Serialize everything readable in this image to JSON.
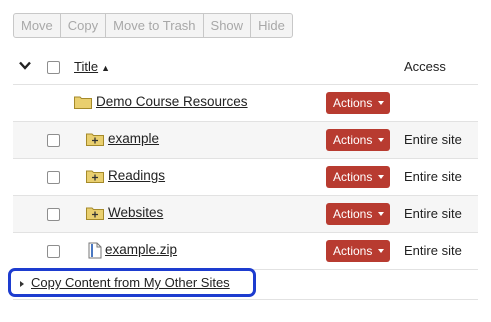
{
  "toolbar": {
    "buttons": [
      "Move",
      "Copy",
      "Move to Trash",
      "Show",
      "Hide"
    ]
  },
  "table": {
    "title_header": "Title",
    "access_header": "Access",
    "rows": [
      {
        "name": "Demo Course Resources",
        "type": "folder",
        "actions": "Actions",
        "access": ""
      },
      {
        "name": "example",
        "type": "folder-plus",
        "actions": "Actions",
        "access": "Entire site"
      },
      {
        "name": "Readings",
        "type": "folder-plus",
        "actions": "Actions",
        "access": "Entire site"
      },
      {
        "name": "Websites",
        "type": "folder-plus",
        "actions": "Actions",
        "access": "Entire site"
      },
      {
        "name": "example.zip",
        "type": "file",
        "actions": "Actions",
        "access": "Entire site"
      }
    ]
  },
  "copy_content": {
    "label": "Copy Content from My Other Sites"
  },
  "colors": {
    "actions_bg": "#b83b30",
    "folder": "#e9cf6f",
    "highlight": "#1d3ccf"
  }
}
